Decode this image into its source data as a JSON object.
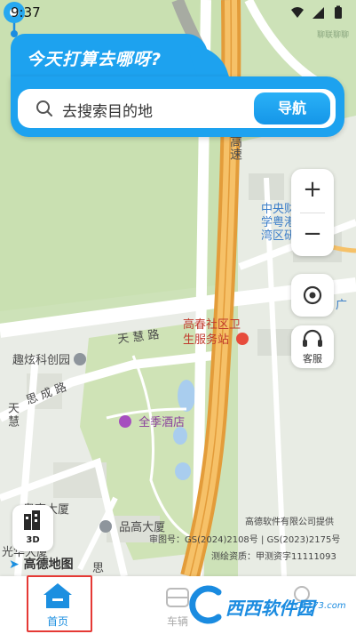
{
  "status_bar": {
    "time": "9:37"
  },
  "corner_small_text": "聊联聊聊",
  "search_card": {
    "title": "今天打算去哪呀?",
    "placeholder": "去搜索目的地",
    "nav_button": "导航",
    "accent_color": "#1da2ef"
  },
  "map": {
    "labels": {
      "highway": "高速",
      "campus": "中央财经大学粤港澳大湾区研究院",
      "campus_line1": "中央财经大",
      "campus_line2": "学粤港澳大",
      "campus_line3": "湾区研究院",
      "clinic_line1": "高春社区卫",
      "clinic_line2": "生服务站",
      "road_tianhui": "天 慧 路",
      "quxuan": "趣炫科创园",
      "sicheng_road": "思 成 路",
      "tianhui_vertical": "天慧",
      "hotel": "全季酒店",
      "gaogao": "粤高大厦",
      "pingao": "品高大厦",
      "guanghua": "光华大厦",
      "si": "思",
      "guang_edge": "广"
    },
    "controls": {
      "zoom_in": "+",
      "zoom_out": "−",
      "service_label": "客服",
      "three_d": "3D"
    },
    "logo": "高德地图",
    "copyright": {
      "line1": "高德软件有限公司提供",
      "line2": "审图号：GS(2024)2108号 | GS(2023)2175号",
      "line3": "测绘资质：甲测资字11111093"
    }
  },
  "bottom_nav": {
    "items": [
      {
        "label": "首页",
        "icon": "home-icon",
        "active": true
      },
      {
        "label": "车辆",
        "icon": "car-icon",
        "active": false
      },
      {
        "label": "",
        "icon": "profile-icon",
        "active": false
      }
    ],
    "active_color": "#1c8fe0"
  },
  "watermark": {
    "text": "西西软件园",
    "site": "CR173.com"
  }
}
